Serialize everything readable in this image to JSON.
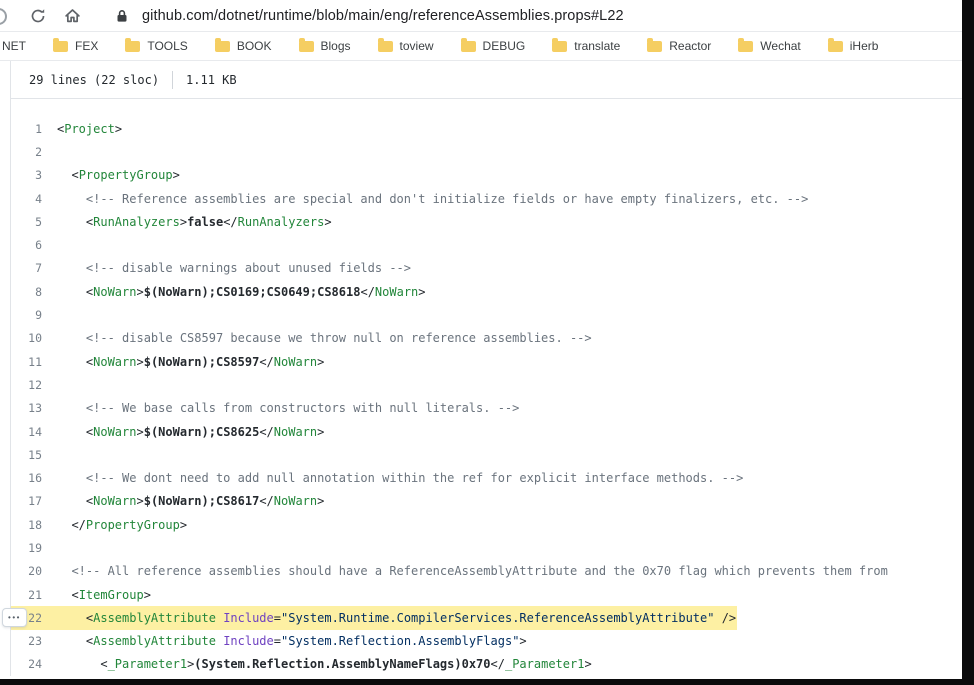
{
  "browser": {
    "url": "github.com/dotnet/runtime/blob/main/eng/referenceAssemblies.props#L22",
    "bookmarks": [
      {
        "label": "NET",
        "icon": false
      },
      {
        "label": "FEX",
        "icon": true
      },
      {
        "label": "TOOLS",
        "icon": true
      },
      {
        "label": "BOOK",
        "icon": true
      },
      {
        "label": "Blogs",
        "icon": true
      },
      {
        "label": "toview",
        "icon": true
      },
      {
        "label": "DEBUG",
        "icon": true
      },
      {
        "label": "translate",
        "icon": true
      },
      {
        "label": "Reactor",
        "icon": true
      },
      {
        "label": "Wechat",
        "icon": true
      },
      {
        "label": "iHerb",
        "icon": true
      }
    ]
  },
  "file_info": {
    "lines": "29 lines (22 sloc)",
    "size": "1.11 KB"
  },
  "colors": {
    "tag": "#22863a",
    "comment": "#6a737d",
    "attr_name": "#6f42c1",
    "string": "#032f62",
    "plain": "#24292e",
    "line_highlight": "#fdf0a3",
    "folder_icon": "#f5ce62"
  },
  "line_menu_dots": "•••",
  "code": {
    "highlighted_line": 22,
    "lines": [
      {
        "n": 1,
        "seg": [
          [
            "p",
            "<"
          ],
          [
            "t",
            "Project"
          ],
          [
            "p",
            ">"
          ]
        ]
      },
      {
        "n": 2,
        "seg": []
      },
      {
        "n": 3,
        "seg": [
          [
            "p",
            "  <"
          ],
          [
            "t",
            "PropertyGroup"
          ],
          [
            "p",
            ">"
          ]
        ]
      },
      {
        "n": 4,
        "seg": [
          [
            "c",
            "    <!-- Reference assemblies are special and don't initialize fields or have empty finalizers, etc. -->"
          ]
        ]
      },
      {
        "n": 5,
        "seg": [
          [
            "p",
            "    <"
          ],
          [
            "t",
            "RunAnalyzers"
          ],
          [
            "p",
            ">"
          ],
          [
            "b",
            "false"
          ],
          [
            "p",
            "</"
          ],
          [
            "t",
            "RunAnalyzers"
          ],
          [
            "p",
            ">"
          ]
        ]
      },
      {
        "n": 6,
        "seg": []
      },
      {
        "n": 7,
        "seg": [
          [
            "c",
            "    <!-- disable warnings about unused fields -->"
          ]
        ]
      },
      {
        "n": 8,
        "seg": [
          [
            "p",
            "    <"
          ],
          [
            "t",
            "NoWarn"
          ],
          [
            "p",
            ">"
          ],
          [
            "b",
            "$(NoWarn);CS0169;CS0649;CS8618"
          ],
          [
            "p",
            "</"
          ],
          [
            "t",
            "NoWarn"
          ],
          [
            "p",
            ">"
          ]
        ]
      },
      {
        "n": 9,
        "seg": []
      },
      {
        "n": 10,
        "seg": [
          [
            "c",
            "    <!-- disable CS8597 because we throw null on reference assemblies. -->"
          ]
        ]
      },
      {
        "n": 11,
        "seg": [
          [
            "p",
            "    <"
          ],
          [
            "t",
            "NoWarn"
          ],
          [
            "p",
            ">"
          ],
          [
            "b",
            "$(NoWarn);CS8597"
          ],
          [
            "p",
            "</"
          ],
          [
            "t",
            "NoWarn"
          ],
          [
            "p",
            ">"
          ]
        ]
      },
      {
        "n": 12,
        "seg": []
      },
      {
        "n": 13,
        "seg": [
          [
            "c",
            "    <!-- We base calls from constructors with null literals. -->"
          ]
        ]
      },
      {
        "n": 14,
        "seg": [
          [
            "p",
            "    <"
          ],
          [
            "t",
            "NoWarn"
          ],
          [
            "p",
            ">"
          ],
          [
            "b",
            "$(NoWarn);CS8625"
          ],
          [
            "p",
            "</"
          ],
          [
            "t",
            "NoWarn"
          ],
          [
            "p",
            ">"
          ]
        ]
      },
      {
        "n": 15,
        "seg": []
      },
      {
        "n": 16,
        "seg": [
          [
            "c",
            "    <!-- We dont need to add null annotation within the ref for explicit interface methods. -->"
          ]
        ]
      },
      {
        "n": 17,
        "seg": [
          [
            "p",
            "    <"
          ],
          [
            "t",
            "NoWarn"
          ],
          [
            "p",
            ">"
          ],
          [
            "b",
            "$(NoWarn);CS8617"
          ],
          [
            "p",
            "</"
          ],
          [
            "t",
            "NoWarn"
          ],
          [
            "p",
            ">"
          ]
        ]
      },
      {
        "n": 18,
        "seg": [
          [
            "p",
            "  </"
          ],
          [
            "t",
            "PropertyGroup"
          ],
          [
            "p",
            ">"
          ]
        ]
      },
      {
        "n": 19,
        "seg": []
      },
      {
        "n": 20,
        "seg": [
          [
            "c",
            "  <!-- All reference assemblies should have a ReferenceAssemblyAttribute and the 0x70 flag which prevents them from"
          ]
        ]
      },
      {
        "n": 21,
        "seg": [
          [
            "p",
            "  <"
          ],
          [
            "t",
            "ItemGroup"
          ],
          [
            "p",
            ">"
          ]
        ]
      },
      {
        "n": 22,
        "hl": true,
        "seg": [
          [
            "p",
            "    <"
          ],
          [
            "t",
            "AssemblyAttribute"
          ],
          [
            "p",
            " "
          ],
          [
            "a",
            "Include"
          ],
          [
            "p",
            "="
          ],
          [
            "s",
            "\"System.Runtime.CompilerServices.ReferenceAssemblyAttribute\""
          ],
          [
            "p",
            " />"
          ]
        ]
      },
      {
        "n": 23,
        "seg": [
          [
            "p",
            "    <"
          ],
          [
            "t",
            "AssemblyAttribute"
          ],
          [
            "p",
            " "
          ],
          [
            "a",
            "Include"
          ],
          [
            "p",
            "="
          ],
          [
            "s",
            "\"System.Reflection.AssemblyFlags\""
          ],
          [
            "p",
            ">"
          ]
        ]
      },
      {
        "n": 24,
        "seg": [
          [
            "p",
            "      <"
          ],
          [
            "t",
            "_Parameter1"
          ],
          [
            "p",
            ">"
          ],
          [
            "b",
            "(System.Reflection.AssemblyNameFlags)0x70"
          ],
          [
            "p",
            "</"
          ],
          [
            "t",
            "_Parameter1"
          ],
          [
            "p",
            ">"
          ]
        ]
      }
    ]
  }
}
